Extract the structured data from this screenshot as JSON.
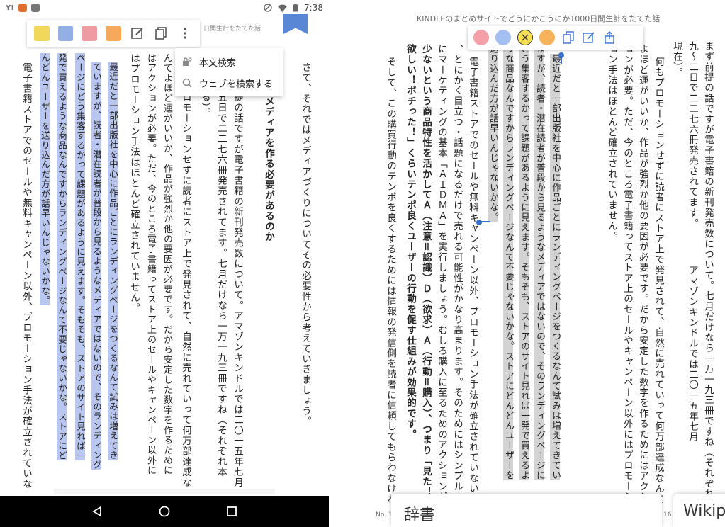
{
  "colors": {
    "left_yellow": "#f2d85a",
    "left_blue": "#94aee6",
    "left_pink": "#f09ba4",
    "left_orange": "#f6a95a",
    "left_highlight": "#b9c6ef",
    "right_pink": "#f5a0a8",
    "right_blue": "#a4bff2",
    "right_yellow": "#f7df55",
    "right_orange": "#f7b25a",
    "right_highlight": "#d3d3d3",
    "bookmark": "#5a86d6",
    "selection": "#3a6fd0"
  },
  "left": {
    "status_time": "7:38",
    "header_title": "日間生計をたてた話",
    "toolbar_icons": [
      "edit-icon",
      "copy-icon",
      "more-vert-icon"
    ],
    "menu": {
      "search_in_book": "本文検索",
      "search_web": "ウェブを検索する"
    },
    "columns": [
      "さて、それではメディアづくりについてその必要性から考えていきましょう。",
      "メディアを作る必要があるのか",
      "提の話ですが電子書籍の新刊発売数について。アマゾンキンドルでは二〇一五年七月",
      "五日で二二七六冊発売されてます。七月だけなら一万一九三冊ですね（それぞれ本",
      "る）。",
      "ロモーションせずに読者にストア上で発見されて、自然に売れていって何万部達成な",
      "んてよほど運がいいか、作品が強烈か他の要因が必要です。だから安定した数字を作るために",
      "はアクションが必要。ただ、今のところ電子書籍ってストア上のセールやキャンペーン以外に",
      "はプロモーション手法はほとんど確立されていません。",
      "最近だと一部出版社を中心に作品ごとにランディングページをつくるなんて試みは増えてき",
      "ていますが、読者・潜在読者が普段から見るようなメディアではないので、そのランディング",
      "ページにどう集客するかって課題があるように見えます。そもそも、ストアのサイト見れば一",
      "発で買えるような商品なんですからランディングページなんて不要じゃないかな。ストアにど",
      "んどんユーザーを送り込んだ方が話早いんじゃないかな。",
      "電子書籍ストアでのセールや無料キャンペーン以外、プロモーション手法が確立されていな"
    ]
  },
  "right": {
    "header_title": "KINDLEのまとめサイトでどうにかこうにか1000日間生計をたてた話",
    "toolbar_icons": [
      "copy-icon",
      "note-icon",
      "share-icon"
    ],
    "columns": [
      "まず前提の話ですが電子書籍の新刊発売数について。七月だけなら一万一九三冊ですね（それぞれ本書製作",
      "九～二日で二二七六冊発売されてます。　　　　アマゾンキンドルでは二〇一五年七月",
      "現在）。",
      "何もプロモーションせずに読者にストア上で発見されて、自然に売れていって何万部達成なんて",
      "よほど運がいいか、作品が強烈か他の要因が必要です。だから安定した数字を作るためにはアクシ",
      "ョンが必要。ただ、今のところ電子書籍ってストア上のセールやキャンペーン以外にはプロモーシ",
      "ョン手法はほとんど確立されていません。",
      "最近だと一部出版社を中心に作品ごとにランディングページをつくるなんて試みは増えてきてい",
      "ますが、読者・潜在読者が普段から見るようなメディアではないので、そのランディングページに",
      "どう集客するかって課題があるように見えます。そもそも、ストアのサイト見れば一発で買えるよ",
      "うな商品なんですからランディングページなんて不要じゃないかな。ストアにどんどんユーザーを",
      "送り込んだ方が話早いんじゃないかな。",
      "電子書籍ストアでのセールや無料キャンペーン以外、プロモーション手法が確立されていない今",
      "、とにかく目立つ・話題になるだけで売れる可能性がかなり高まります。そのためにはシンプル",
      "にマーケティングの基本「ＡＩＤＭＡ」を実行しましょう。むしろ購入に至るためのアクションが",
      "少ないという商品特性を活かしてＡ（注意＝認識）Ｄ（欲求）Ａ（行動＝購入）、つまり「見た！",
      "欲しい！ポチった！」くらいテンポ良くユーザーの行動を促す仕組みが効果的です。",
      "そして、この購買行動のテンポを良くするためには情報の発信側を読者に信頼してもらわなけれ"
    ],
    "dictionary_label": "辞書",
    "wikipedia_label": "Wikip",
    "location_left": "No. 1",
    "location_right": "16"
  }
}
